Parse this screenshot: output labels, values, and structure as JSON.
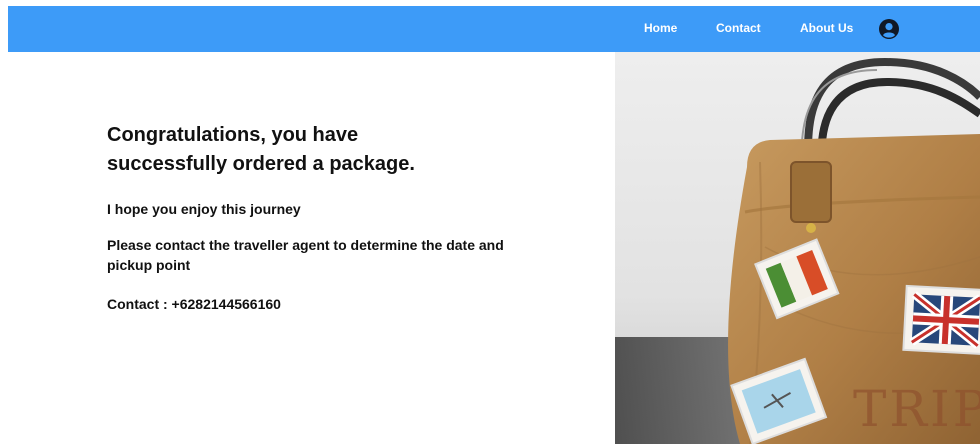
{
  "nav": {
    "home": "Home",
    "contact": "Contact",
    "about": "About Us",
    "user_icon": "user-circle-icon"
  },
  "content": {
    "headline": "Congratulations, you have successfully ordered a package.",
    "enjoy": "I hope you enjoy this journey",
    "instruction": "Please contact the traveller agent to determine the date and pickup point",
    "contact": "Contact : +6282144566160"
  },
  "colors": {
    "navbar": "#3d9bf8",
    "text": "#111111"
  },
  "image": {
    "trip_text": "TRIP"
  }
}
